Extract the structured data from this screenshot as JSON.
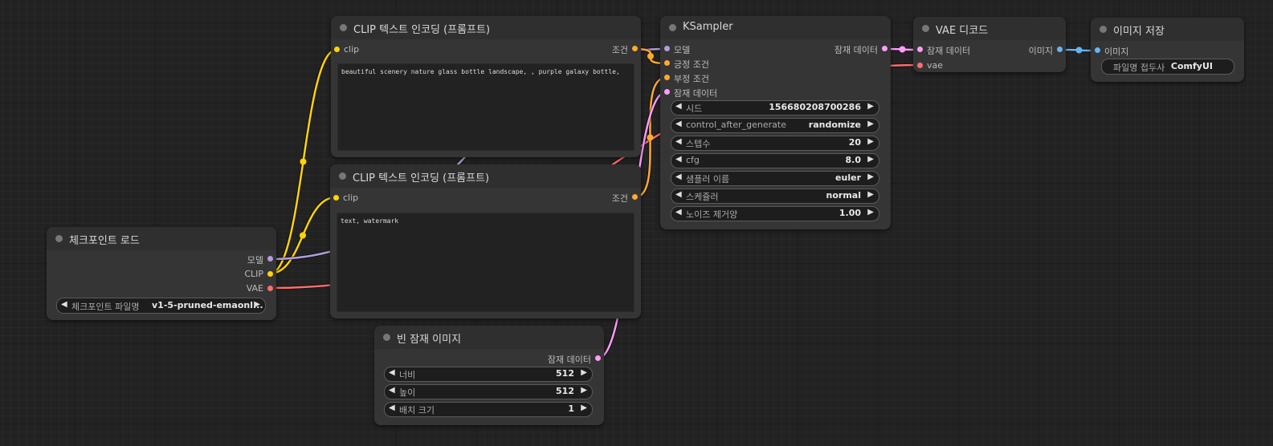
{
  "colors": {
    "model": "#b39ddb",
    "clip": "#ffd500",
    "vae": "#ff6e6e",
    "conditioning": "#ffa931",
    "latent": "#ff9cf9",
    "image": "#64b5f6"
  },
  "nodes": {
    "checkpoint": {
      "title": "체크포인트 로드",
      "outputs": {
        "model": "모델",
        "clip": "CLIP",
        "vae": "VAE"
      },
      "widget": {
        "name": "체크포인트 파일명",
        "value": "v1-5-pruned-emaonl..."
      }
    },
    "clip_pos": {
      "title": "CLIP 텍스트 인코딩 (프롬프트)",
      "input": "clip",
      "output": "조건",
      "text": "beautiful scenery nature glass bottle landscape, , purple galaxy bottle,"
    },
    "clip_neg": {
      "title": "CLIP 텍스트 인코딩 (프롬프트)",
      "input": "clip",
      "output": "조건",
      "text": "text, watermark"
    },
    "empty_latent": {
      "title": "빈 잠재 이미지",
      "output": "잠재 데이터",
      "widgets": [
        {
          "name": "너비",
          "value": "512"
        },
        {
          "name": "높이",
          "value": "512"
        },
        {
          "name": "배치 크기",
          "value": "1"
        }
      ]
    },
    "ksampler": {
      "title": "KSampler",
      "inputs": {
        "model": "모델",
        "positive": "긍정 조건",
        "negative": "부정 조건",
        "latent": "잠재 데이터"
      },
      "output": "잠재 데이터",
      "widgets": [
        {
          "name": "시드",
          "value": "156680208700286"
        },
        {
          "name": "control_after_generate",
          "value": "randomize"
        },
        {
          "name": "스텝수",
          "value": "20"
        },
        {
          "name": "cfg",
          "value": "8.0"
        },
        {
          "name": "샘플러 이름",
          "value": "euler"
        },
        {
          "name": "스케쥴러",
          "value": "normal"
        },
        {
          "name": "노이즈 제거양",
          "value": "1.00"
        }
      ]
    },
    "vae_decode": {
      "title": "VAE 디코드",
      "inputs": {
        "samples": "잠재 데이터",
        "vae": "vae"
      },
      "output": "이미지"
    },
    "save_image": {
      "title": "이미지 저장",
      "input": "이미지",
      "widget": {
        "name": "파일명 접두사",
        "value": "ComfyUI"
      }
    }
  }
}
